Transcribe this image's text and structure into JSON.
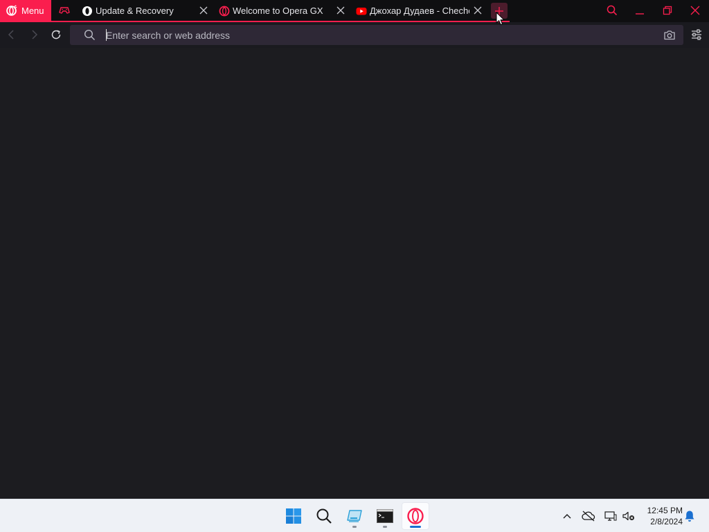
{
  "browser": {
    "menu_label": "Menu",
    "tabs": [
      {
        "title": "Update & Recovery",
        "favicon": "opera-icon"
      },
      {
        "title": "Welcome to Opera GX",
        "favicon": "opera-gx-icon"
      },
      {
        "title": "Джохар Дудаев - Chechen",
        "favicon": "youtube-icon"
      }
    ],
    "address_bar": {
      "placeholder": "Enter search or web address",
      "value": ""
    },
    "colors": {
      "accent": "#fa1e4e",
      "tabstrip_bg": "#0f0f11",
      "urlbar_bg": "#2e2836",
      "content_bg": "#1c1c20"
    }
  },
  "taskbar": {
    "apps": [
      {
        "name": "start",
        "icon": "windows-logo-icon"
      },
      {
        "name": "search",
        "icon": "search-icon"
      },
      {
        "name": "file-explorer",
        "icon": "drive-window-icon"
      },
      {
        "name": "terminal",
        "icon": "command-prompt-icon"
      },
      {
        "name": "opera-gx",
        "icon": "opera-gx-icon"
      }
    ],
    "clock": {
      "time": "12:45 PM",
      "date": "2/8/2024"
    },
    "tray": [
      "chevron-up-icon",
      "onedrive-offline-icon",
      "network-icon",
      "volume-muted-icon",
      "notification-bell-icon"
    ]
  }
}
